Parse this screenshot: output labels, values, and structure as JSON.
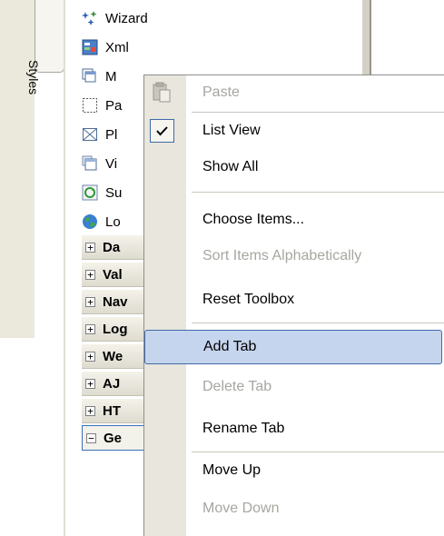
{
  "side_tab": {
    "label": "Styles"
  },
  "toolbox": {
    "items": [
      {
        "label": "Wizard",
        "icon": "wizard-icon"
      },
      {
        "label": "Xml",
        "icon": "xml-icon"
      },
      {
        "label": "M",
        "icon": "multiview-icon"
      },
      {
        "label": "Pa",
        "icon": "panel-icon"
      },
      {
        "label": "Pl",
        "icon": "placeholder-icon"
      },
      {
        "label": "Vi",
        "icon": "view-icon"
      },
      {
        "label": "Su",
        "icon": "substitution-icon"
      },
      {
        "label": "Lo",
        "icon": "localize-icon"
      }
    ],
    "groups": [
      {
        "label": "Da",
        "state": "collapsed"
      },
      {
        "label": "Val",
        "state": "collapsed"
      },
      {
        "label": "Nav",
        "state": "collapsed"
      },
      {
        "label": "Log",
        "state": "collapsed"
      },
      {
        "label": "We",
        "state": "collapsed"
      },
      {
        "label": "AJ",
        "state": "collapsed"
      },
      {
        "label": "HT",
        "state": "collapsed"
      },
      {
        "label": "Ge",
        "state": "expanded"
      }
    ]
  },
  "context_menu": {
    "items": [
      {
        "label": "Paste",
        "disabled": true,
        "icon": "paste-icon"
      },
      {
        "label": "List View",
        "checked": true
      },
      {
        "label": "Show All"
      },
      {
        "label": "Choose Items..."
      },
      {
        "label": "Sort Items Alphabetically",
        "disabled": true
      },
      {
        "label": "Reset Toolbox"
      },
      {
        "label": "Add Tab",
        "highlighted": true
      },
      {
        "label": "Delete Tab",
        "disabled": true
      },
      {
        "label": "Rename Tab"
      },
      {
        "label": "Move Up"
      },
      {
        "label": "Move Down",
        "disabled": true
      }
    ]
  },
  "colors": {
    "menu_highlight": "#c6d5ee",
    "menu_highlight_border": "#3f6aa8",
    "disabled_text": "#a7a6a0",
    "menu_strip": "#e8e6dd"
  }
}
